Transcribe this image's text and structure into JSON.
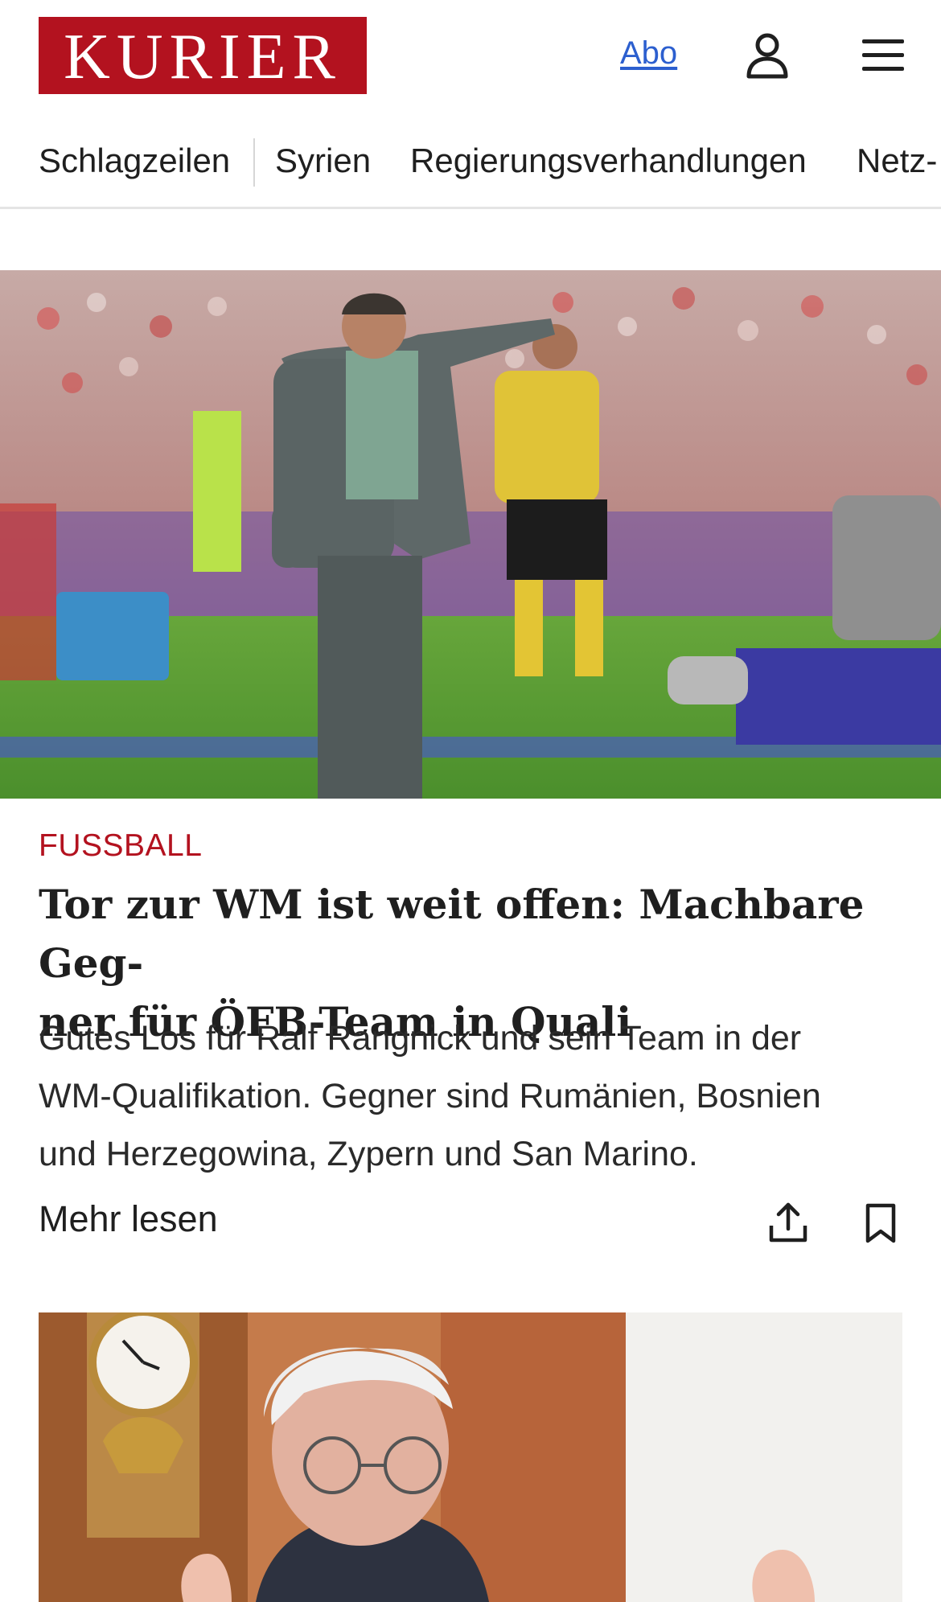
{
  "header": {
    "logo_text": "KURIER",
    "abo_label": "Abo",
    "user_icon": "user-icon",
    "menu_icon": "hamburger-menu-icon",
    "brand_color": "#b3121f",
    "link_color": "#2c5fcf"
  },
  "nav": {
    "items": [
      {
        "label": "Schlagzeilen"
      },
      {
        "label": "Syrien"
      },
      {
        "label": "Regierungsverhandlungen"
      },
      {
        "label": "Netz-"
      }
    ]
  },
  "articles": [
    {
      "image_alt": "Trainer gestikuliert am Spielfeldrand, Schiedsrichter im Hintergrund",
      "category": "FUSSBALL",
      "headline": "Tor zur WM ist weit offen: Machbare Geg-ner für ÖFB-Team in Quali",
      "headline_line1": "Tor zur WM ist weit offen: Machbare Geg-",
      "headline_line2": "ner für ÖFB-Team in Quali",
      "teaser_line1": "Gutes Los für Ralf Rangnick und sein Team in der",
      "teaser_line2": "WM-Qualifikation. Gegner sind Rumänien, Bosnien",
      "teaser_line3": "und Herzegowina, Zypern und San Marino.",
      "more_label": "Mehr lesen",
      "share_icon": "share-icon",
      "bookmark_icon": "bookmark-icon"
    },
    {
      "image_alt": "Älterer Mann mit Brille vor einer Kaminuhr"
    }
  ]
}
